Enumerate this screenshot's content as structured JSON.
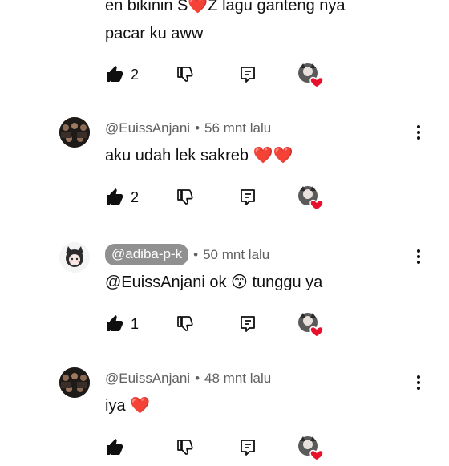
{
  "comments": [
    {
      "text_line1": "en bikinin S❤️Z lagu ganteng nya",
      "text_line2": "pacar ku aww",
      "likes": "2"
    },
    {
      "author": "@EuissAnjani",
      "time": "56 mnt lalu",
      "text": "aku udah lek sakreb ❤️❤️",
      "likes": "2"
    },
    {
      "author": "@adiba-p-k",
      "time": "50 mnt lalu",
      "text": "@EuissAnjani ok 😙 tunggu ya",
      "likes": "1"
    },
    {
      "author": "@EuissAnjani",
      "time": "48 mnt lalu",
      "text": "iya ❤️",
      "likes": ""
    }
  ],
  "separator": "•",
  "colors": {
    "text": "#0f0f0f",
    "meta": "#606060",
    "pill": "#909090",
    "heart": "#e8102a"
  }
}
